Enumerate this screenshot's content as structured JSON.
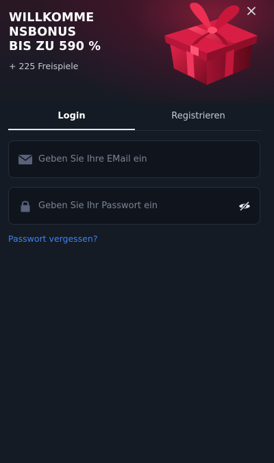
{
  "promo": {
    "title_line1": "WILLKOMME",
    "title_line2": "NSBONUS",
    "title_line3": "BIS ZU 590 %",
    "subtitle": "+ 225 Freispiele"
  },
  "tabs": {
    "login": "Login",
    "register": "Registrieren",
    "active": "login"
  },
  "form": {
    "email_placeholder": "Geben Sie Ihre EMail ein",
    "email_value": "",
    "password_placeholder": "Geben Sie Ihr Passwort ein",
    "password_value": "",
    "forgot_link": "Passwort vergessen?"
  },
  "icons": {
    "close": "close-icon",
    "gift": "gift-box-icon",
    "email": "envelope-icon",
    "password": "lock-icon",
    "visibility": "eye-off-icon"
  },
  "colors": {
    "background": "#151b24",
    "field_background": "#10151d",
    "link": "#3b82f6",
    "gift_red": "#c4163a"
  }
}
